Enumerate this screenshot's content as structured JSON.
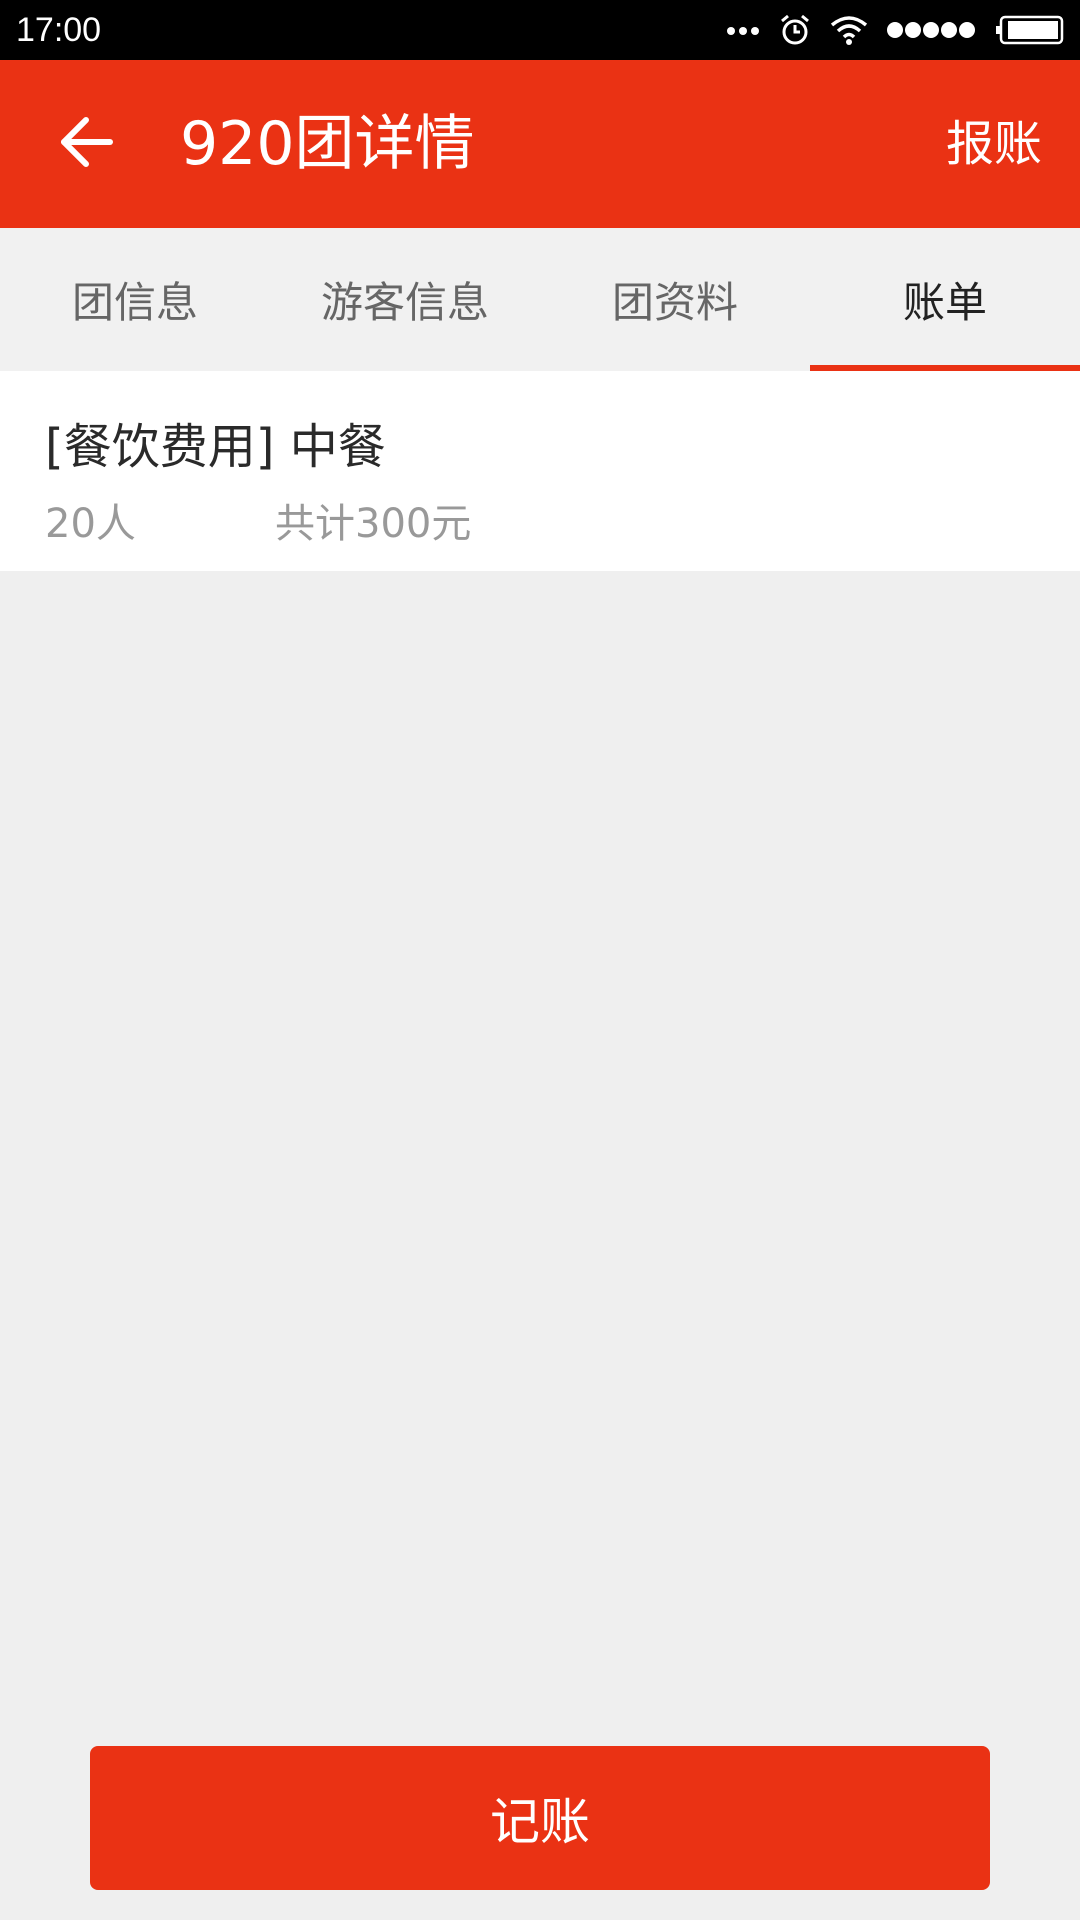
{
  "status_bar": {
    "time": "17:00",
    "icons": [
      "more-dots-icon",
      "alarm-icon",
      "wifi-icon",
      "signal-icon",
      "battery-icon"
    ]
  },
  "app_bar": {
    "back_icon": "arrow-left-icon",
    "title": "920团详情",
    "action_label": "报账"
  },
  "tabs": [
    {
      "label": "团信息",
      "active": false
    },
    {
      "label": "游客信息",
      "active": false
    },
    {
      "label": "团资料",
      "active": false
    },
    {
      "label": "账单",
      "active": true
    }
  ],
  "bills": [
    {
      "title": "[餐饮费用] 中餐",
      "people": "20人",
      "total": "共计300元"
    }
  ],
  "footer": {
    "record_label": "记账"
  },
  "colors": {
    "accent": "#ea3214",
    "status_bar": "#000000",
    "background": "#efefef",
    "tab_background": "#f1f1f1",
    "card": "#ffffff",
    "primary_text": "#2a2a2a",
    "secondary_text": "#999999"
  }
}
